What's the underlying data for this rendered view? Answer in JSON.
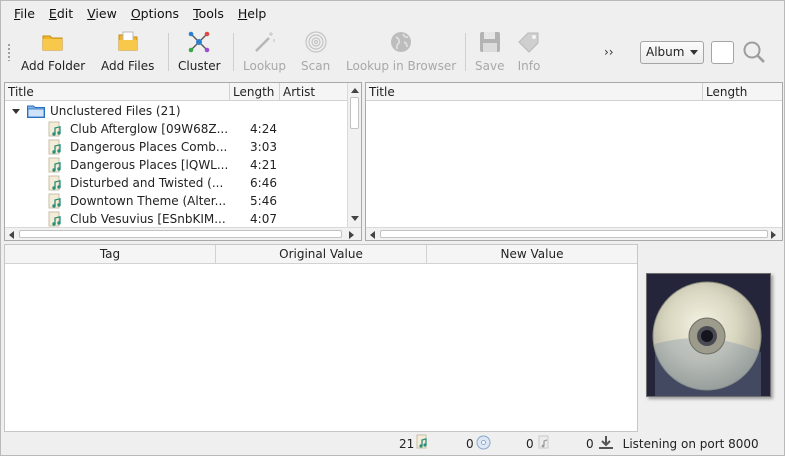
{
  "menu": [
    {
      "label": "File",
      "mnemonic": "F",
      "rest": "ile"
    },
    {
      "label": "Edit",
      "mnemonic": "E",
      "rest": "dit"
    },
    {
      "label": "View",
      "mnemonic": "V",
      "rest": "iew"
    },
    {
      "label": "Options",
      "mnemonic": "O",
      "rest": "ptions"
    },
    {
      "label": "Tools",
      "mnemonic": "T",
      "rest": "ools"
    },
    {
      "label": "Help",
      "mnemonic": "H",
      "rest": "elp"
    }
  ],
  "toolbar": {
    "add_folder": "Add Folder",
    "add_files": "Add Files",
    "cluster": "Cluster",
    "lookup": "Lookup",
    "scan": "Scan",
    "lookup_browser": "Lookup in Browser",
    "save": "Save",
    "info": "Info",
    "more": "››",
    "search_mode": "Album"
  },
  "left_pane": {
    "columns": [
      "Title",
      "Length",
      "Artist"
    ],
    "group": {
      "label": "Unclustered Files (21)"
    },
    "files": [
      {
        "title": "Club Afterglow [09W68Z...",
        "length": "4:24"
      },
      {
        "title": "Dangerous Places Comb...",
        "length": "3:03"
      },
      {
        "title": "Dangerous Places [lQWL...",
        "length": "4:21"
      },
      {
        "title": "Disturbed and Twisted (...",
        "length": "6:46"
      },
      {
        "title": "Downtown Theme (Alter...",
        "length": "5:46"
      },
      {
        "title": "Club Vesuvius [ESnbKIM...",
        "length": "4:07"
      }
    ]
  },
  "right_pane": {
    "columns": [
      "Title",
      "Length"
    ]
  },
  "metadata": {
    "columns": [
      "Tag",
      "Original Value",
      "New Value"
    ]
  },
  "status": {
    "files": "21",
    "albums": "0",
    "pending_files": "0",
    "pending_requests": "0",
    "message": "Listening on port 8000"
  },
  "colors": {
    "folder": "#f0b429",
    "accent": "#2b7fd0",
    "disabled_text": "#a8a8a8"
  }
}
